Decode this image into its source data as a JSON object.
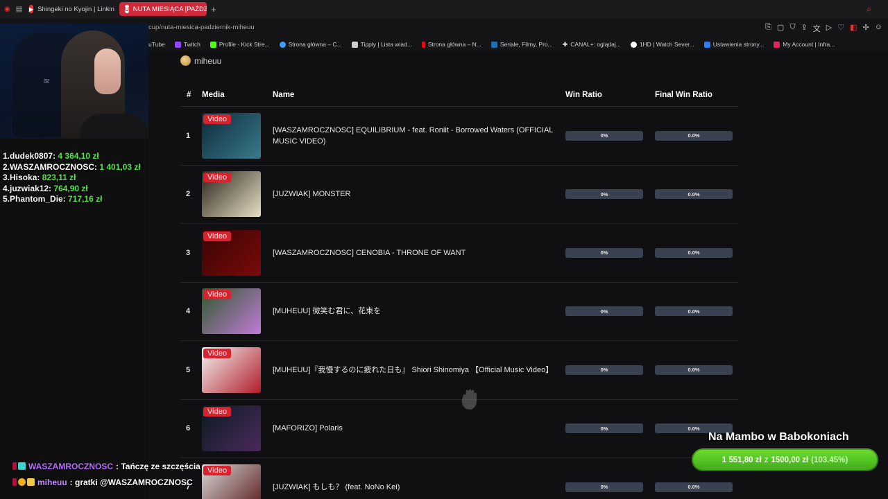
{
  "browser": {
    "tabs": [
      {
        "label": "Shingeki no Kyojin | Linkin",
        "icon": "youtube-icon"
      },
      {
        "label": "NUTA MIESIĄCA [PAŹDZ",
        "icon": "u-logo-icon"
      }
    ],
    "new_tab": "+",
    "url": "cup/nuta-miesica-padziernik-miheuu",
    "bookmarks": [
      {
        "label": "uTube",
        "color": "#ff2b2b"
      },
      {
        "label": "Twitch",
        "color": "#9146ff"
      },
      {
        "label": "Profile - Kick Stre...",
        "color": "#53fc18"
      },
      {
        "label": "Strona główna – C...",
        "color": "#3aa0ff"
      },
      {
        "label": "Tipply | Lista wiad...",
        "color": "#cfcfcf"
      },
      {
        "label": "Strona główna – N...",
        "color": "#e50914"
      },
      {
        "label": "Seriale, Filmy, Pro...",
        "color": "#1f6fb5"
      },
      {
        "label": "CANAL+: oglądaj...",
        "color": "#ffffff"
      },
      {
        "label": "1HD | Watch Sever...",
        "color": "#ffffff"
      },
      {
        "label": "Ustawienia strony...",
        "color": "#2f7df6"
      },
      {
        "label": "My Account | Infra...",
        "color": "#e0245e"
      }
    ]
  },
  "page": {
    "author": "miheuu",
    "columns": [
      "#",
      "Media",
      "Name",
      "Win Ratio",
      "Final Win Ratio"
    ],
    "video_badge": "Video",
    "rows": [
      {
        "num": "1",
        "name": "[WASZAMROCZNOSC] EQUILIBRIUM - feat. Roniit - Borrowed Waters (OFFICIAL MUSIC VIDEO)",
        "win": "0%",
        "final": "0.0%",
        "thumb": [
          "#0d2a3a",
          "#3a7a8a"
        ]
      },
      {
        "num": "2",
        "name": "[JUZWIAK] MONSTER",
        "win": "0%",
        "final": "0.0%",
        "thumb": [
          "#2a2418",
          "#e8e0c8"
        ]
      },
      {
        "num": "3",
        "name": "[WASZAMROCZNOSC] CENOBIA - THRONE OF WANT",
        "win": "0%",
        "final": "0.0%",
        "thumb": [
          "#3a0404",
          "#7a0a0a"
        ]
      },
      {
        "num": "4",
        "name": "[MUHEUU] 微笑む君に、花束を",
        "win": "0%",
        "final": "0.0%",
        "thumb": [
          "#2e5a2a",
          "#c27ad8"
        ]
      },
      {
        "num": "5",
        "name": "[MUHEUU]『我慢するのに疲れた日も』 Shiori Shinomiya 【Official Music Video】",
        "win": "0%",
        "final": "0.0%",
        "thumb": [
          "#f4f4f4",
          "#b01d2a"
        ]
      },
      {
        "num": "6",
        "name": "[MAFORIZO] Polaris",
        "win": "0%",
        "final": "0.0%",
        "thumb": [
          "#0a1a22",
          "#4a2a5a"
        ]
      },
      {
        "num": "7",
        "name": "[JUZWIAK] もしも？ (feat. NoNo Kei)",
        "win": "0%",
        "final": "0.0%",
        "thumb": [
          "#d8d8d8",
          "#5a1a1a"
        ]
      }
    ]
  },
  "overlay": {
    "leaderboard": [
      {
        "rank": "1.",
        "name": "dudek0807:",
        "amount": "4 364,10 zł"
      },
      {
        "rank": "2.",
        "name": "WASZAMROCZNOSC:",
        "amount": "1 401,03 zł"
      },
      {
        "rank": "3.",
        "name": "Hisoka:",
        "amount": "823,11 zł"
      },
      {
        "rank": "4.",
        "name": "juzwiak12:",
        "amount": "764,90 zł"
      },
      {
        "rank": "5.",
        "name": "Phantom_Die:",
        "amount": "717,16 zł"
      }
    ],
    "chat": [
      {
        "user": "WASZAMROCZNOSC",
        "message": " : Tańczę ze szczęścia"
      },
      {
        "user": "miheuu",
        "message": " : gratki @WASZAMROCZNOSC"
      }
    ],
    "goal": {
      "title": "Na Mambo w Babokoniach",
      "current": "1 551,80 zł",
      "sep": "z",
      "target": "1500,00 zł",
      "percent": "(103.45%)",
      "percent_value": 103.45,
      "color": "#52c41a"
    }
  }
}
